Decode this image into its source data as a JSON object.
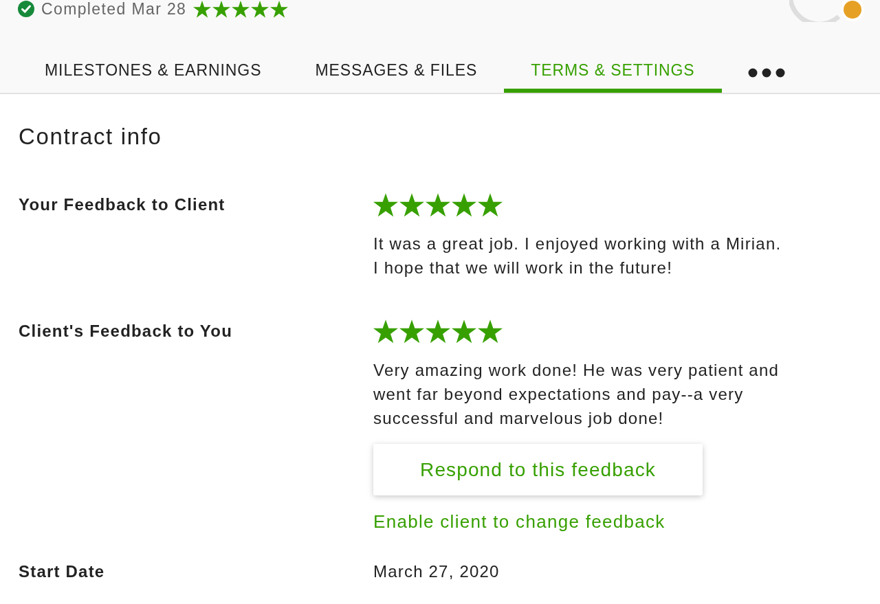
{
  "header": {
    "status": "Completed Mar 28",
    "stars": 5
  },
  "tabs": [
    {
      "label": "MILESTONES & EARNINGS",
      "selected": false
    },
    {
      "label": "MESSAGES & FILES",
      "selected": false
    },
    {
      "label": "TERMS & SETTINGS",
      "selected": true
    }
  ],
  "section": {
    "title": "Contract info"
  },
  "feedback": [
    {
      "label": "Your Feedback to Client",
      "stars": 5,
      "comment": "It was a great job. I enjoyed working with a Mirian. I hope that we will work in the future!"
    },
    {
      "label": "Client's Feedback to You",
      "stars": 5,
      "comment": "Very amazing work done! He was very patient and went far beyond expectations and pay--a very successful and marvelous job done!",
      "respond_button": "Respond to this feedback",
      "enable_link": "Enable client to change feedback"
    }
  ],
  "details": [
    {
      "label": "Start Date",
      "value": "March 27, 2020"
    }
  ]
}
